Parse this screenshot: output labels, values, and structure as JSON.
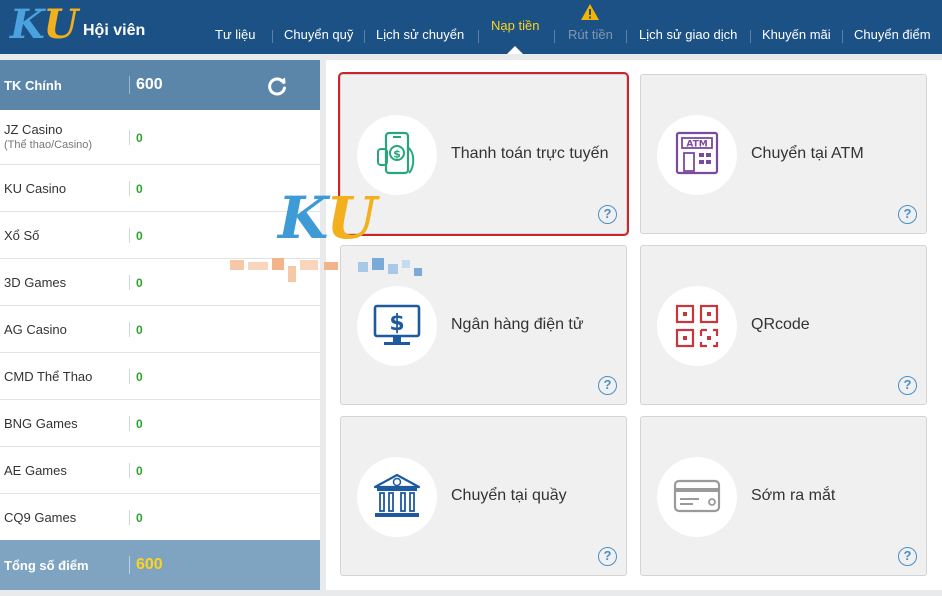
{
  "header": {
    "logo": "KU",
    "member_title": "Hội viên",
    "nav": [
      {
        "label": "Tư liệu",
        "state": "normal"
      },
      {
        "label": "Chuyển quỹ",
        "state": "normal"
      },
      {
        "label": "Lịch sử chuyển",
        "state": "normal"
      },
      {
        "label": "Nạp tiền",
        "state": "active"
      },
      {
        "label": "Rút tiền",
        "state": "disabled"
      },
      {
        "label": "Lịch sử giao dịch",
        "state": "normal"
      },
      {
        "label": "Khuyến mãi",
        "state": "normal"
      },
      {
        "label": "Chuyển điểm",
        "state": "normal"
      }
    ]
  },
  "accounts": {
    "main": {
      "label": "TK Chính",
      "value": "600"
    },
    "items": [
      {
        "name": "JZ Casino",
        "sub": "(Thể thao/Casino)",
        "value": "0"
      },
      {
        "name": "KU Casino",
        "value": "0"
      },
      {
        "name": "Xổ Số",
        "value": "0"
      },
      {
        "name": "3D Games",
        "value": "0"
      },
      {
        "name": "AG Casino",
        "value": "0"
      },
      {
        "name": "CMD Thể Thao",
        "value": "0"
      },
      {
        "name": "BNG Games",
        "value": "0"
      },
      {
        "name": "AE Games",
        "value": "0"
      },
      {
        "name": "CQ9 Games",
        "value": "0"
      }
    ],
    "total": {
      "label": "Tổng số điểm",
      "value": "600"
    }
  },
  "watermark": "KU",
  "deposit_methods": [
    {
      "title": "Thanh toán trực tuyến",
      "icon": "mobile-payment-icon",
      "selected": true,
      "help": "?"
    },
    {
      "title": "Chuyển tại ATM",
      "icon": "atm-icon",
      "selected": false,
      "help": "?"
    },
    {
      "title": "Ngân hàng điện tử",
      "icon": "monitor-dollar-icon",
      "selected": false,
      "help": "?"
    },
    {
      "title": "QRcode",
      "icon": "qr-code-icon",
      "selected": false,
      "help": "?"
    },
    {
      "title": "Chuyển tại quầy",
      "icon": "bank-building-icon",
      "selected": false,
      "help": "?"
    },
    {
      "title": "Sớm ra mắt",
      "icon": "credit-card-icon",
      "selected": false,
      "help": "?"
    }
  ],
  "colors": {
    "header_bg": "#1c5185",
    "nav_active": "#ffd21f",
    "main_account_bg": "#5b86aa",
    "total_bg": "#7fa4c1",
    "balance_zero": "#2aa52a",
    "selected_border": "#c8252c"
  }
}
